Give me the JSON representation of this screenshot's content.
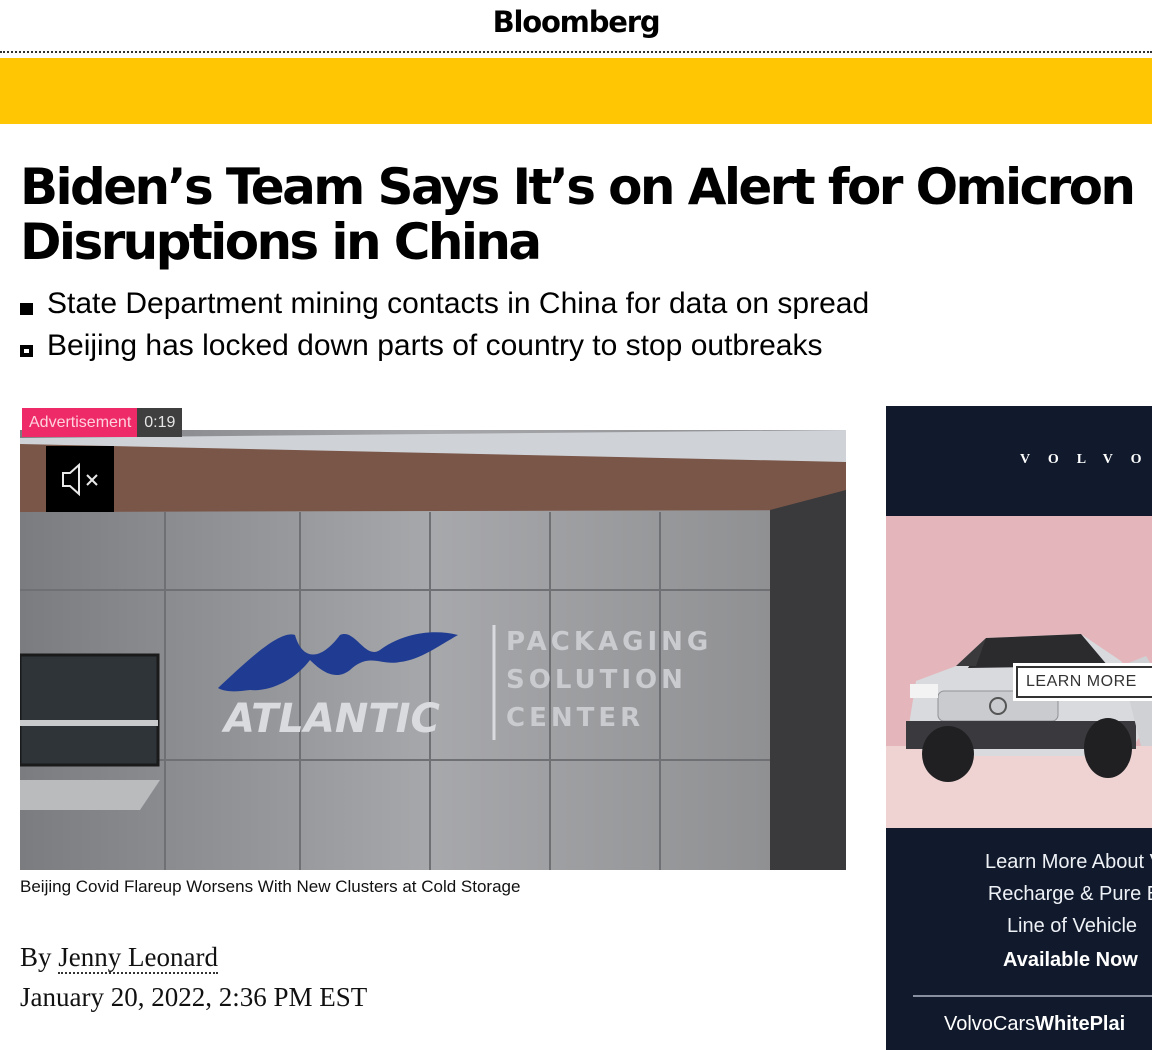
{
  "header": {
    "logo": "Bloomberg"
  },
  "colors": {
    "banner_yellow": "#ffc703",
    "ad_pink": "#ee2a68",
    "ad_navy": "#111a2c"
  },
  "article": {
    "headline_line1": "Biden’s Team Says It’s on Alert for Omicron",
    "headline_line2": "Disruptions in China",
    "bullets": [
      "State Department mining contacts in China for data on spread",
      "Beijing has locked down parts of country to stop outbreaks"
    ],
    "byline_prefix": "By",
    "author": "Jenny Leonard",
    "date": "January 20, 2022, 2:36 PM EST"
  },
  "video": {
    "ad_label": "Advertisement",
    "ad_time": "0:19",
    "mute_icon": "speaker-muted-icon",
    "sign_brand": "ATLANTIC",
    "sign_line1": "PACKAGING",
    "sign_line2": "SOLUTION",
    "sign_line3": "CENTER",
    "caption": "Beijing Covid Flareup Worsens With New Clusters at Cold Storage"
  },
  "side_ad": {
    "brand": "VOLVO",
    "button_label": "LEARN MORE",
    "copy_line1": "Learn More About V",
    "copy_line2": "Recharge & Pure E",
    "copy_line3": "Line of Vehicle",
    "cta": "Available Now",
    "dealer_prefix": "VolvoCars",
    "dealer_name": "WhitePlai"
  }
}
